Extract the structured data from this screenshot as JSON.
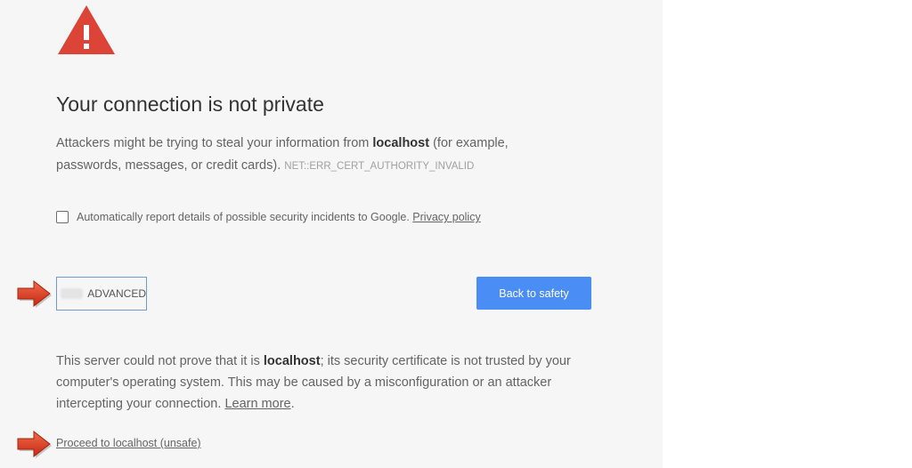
{
  "heading": {
    "title": "Your connection is not private"
  },
  "intro": {
    "part1": "Attackers might be trying to steal your information from ",
    "host": "localhost",
    "part2": " (for example, passwords, messages, or credit cards).",
    "error_code": "NET::ERR_CERT_AUTHORITY_INVALID"
  },
  "report": {
    "label": "Automatically report details of possible security incidents to Google.",
    "checked": false,
    "privacy_link": "Privacy policy"
  },
  "buttons": {
    "advanced_label": "ADVANCED",
    "back_label": "Back to safety"
  },
  "details": {
    "part1": "This server could not prove that it is ",
    "host": "localhost",
    "part2": "; its security certificate is not trusted by your computer's operating system. This may be caused by a misconfiguration or an attacker intercepting your connection.",
    "learn_more": "Learn more",
    "end": "."
  },
  "proceed": {
    "label": "Proceed to localhost (unsafe)"
  },
  "icons": {
    "warning": "warning-triangle-icon",
    "annotation_arrow": "right-arrow-icon"
  },
  "colors": {
    "warning_red": "#db4437",
    "primary_blue": "#4a8df4",
    "background": "#f6f6f6",
    "annotation_arrow": "#d9341c"
  }
}
